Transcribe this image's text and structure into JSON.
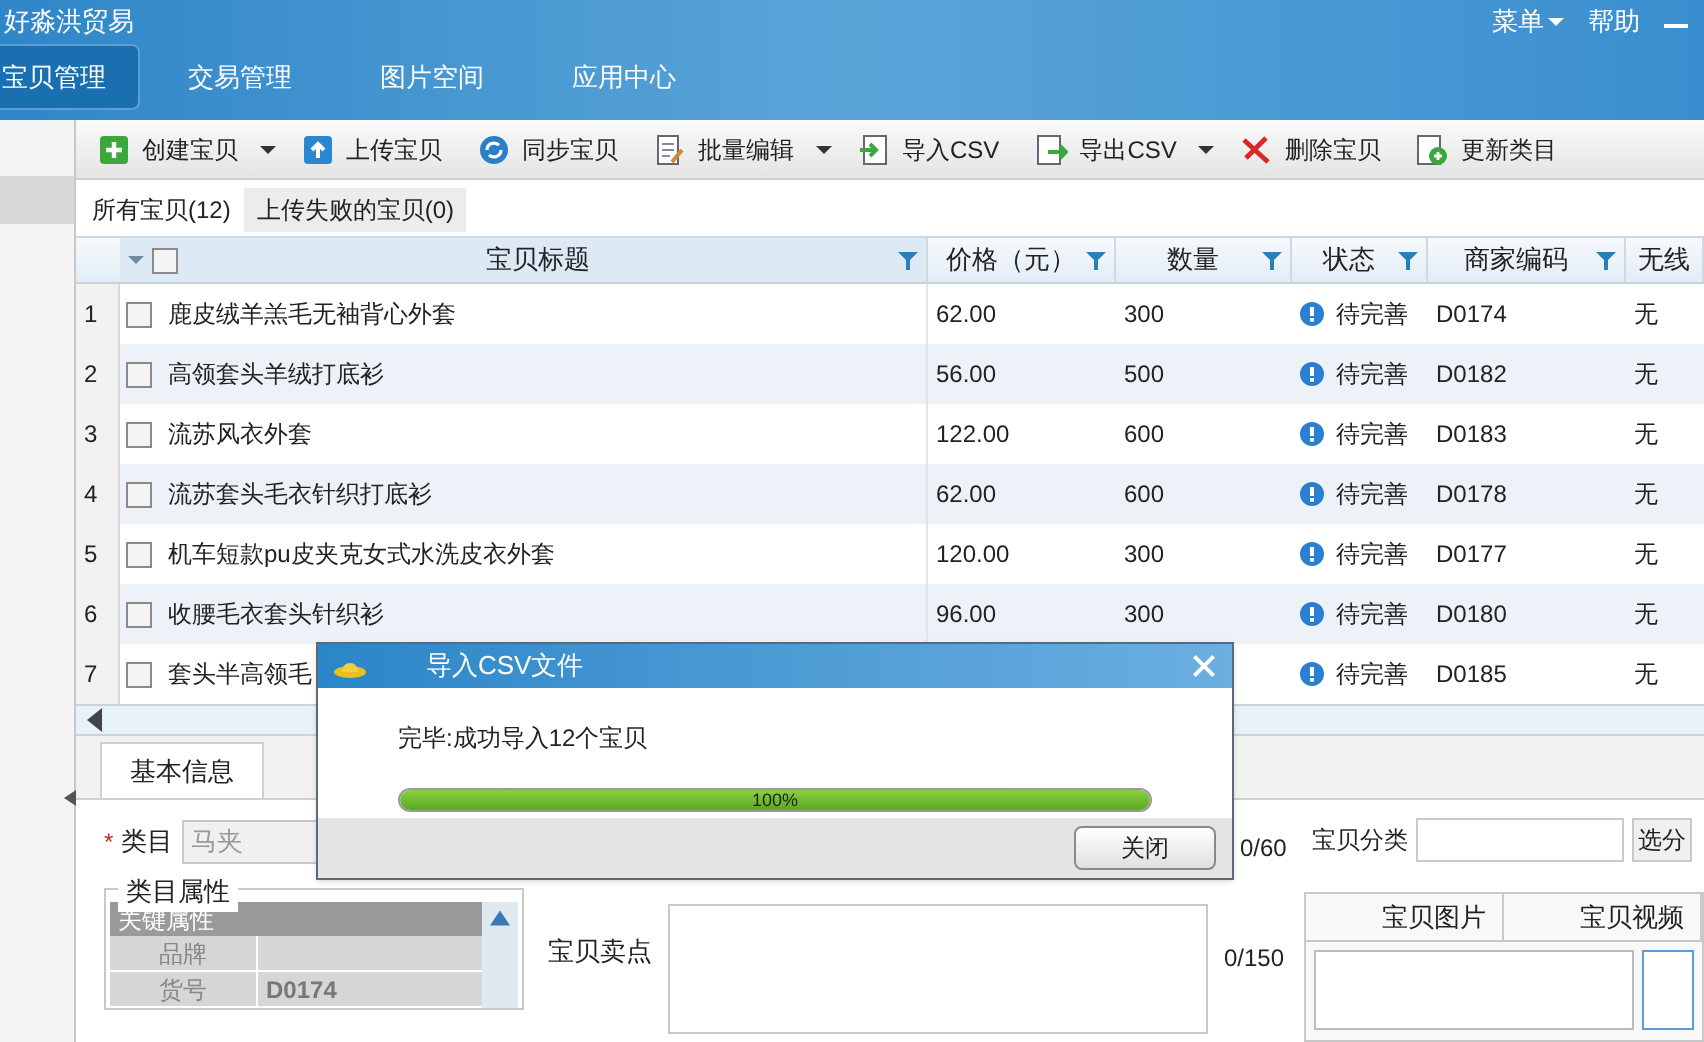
{
  "header": {
    "title": "好淼洪贸易",
    "menu": "菜单",
    "help": "帮助"
  },
  "nav": [
    {
      "label": "宝贝管理",
      "selected": true
    },
    {
      "label": "交易管理",
      "selected": false
    },
    {
      "label": "图片空间",
      "selected": false
    },
    {
      "label": "应用中心",
      "selected": false
    }
  ],
  "toolbar": [
    {
      "label": "创建宝贝",
      "kind": "plus",
      "dropdown": true
    },
    {
      "label": "上传宝贝",
      "kind": "upload",
      "dropdown": false
    },
    {
      "label": "同步宝贝",
      "kind": "sync",
      "dropdown": false
    },
    {
      "label": "批量编辑",
      "kind": "edit",
      "dropdown": true
    },
    {
      "label": "导入CSV",
      "kind": "import",
      "dropdown": false
    },
    {
      "label": "导出CSV",
      "kind": "export",
      "dropdown": true
    },
    {
      "label": "删除宝贝",
      "kind": "delete",
      "dropdown": false
    },
    {
      "label": "更新类目",
      "kind": "refresh",
      "dropdown": false
    }
  ],
  "subtabs": [
    {
      "label": "所有宝贝(12)",
      "selected": true
    },
    {
      "label": "上传失败的宝贝(0)",
      "selected": false
    }
  ],
  "table": {
    "select_all_checked": false,
    "columns": [
      "宝贝标题",
      "价格（元）",
      "数量",
      "状态",
      "商家编码",
      "无线"
    ],
    "rows": [
      {
        "index": "1",
        "title": "鹿皮绒羊羔毛无袖背心外套",
        "price": "62.00",
        "qty": "300",
        "status": "待完善",
        "code": "D0174",
        "mobile": "无",
        "checked": false
      },
      {
        "index": "2",
        "title": "高领套头羊绒打底衫",
        "price": "56.00",
        "qty": "500",
        "status": "待完善",
        "code": "D0182",
        "mobile": "无",
        "checked": false
      },
      {
        "index": "3",
        "title": "流苏风衣外套",
        "price": "122.00",
        "qty": "600",
        "status": "待完善",
        "code": "D0183",
        "mobile": "无",
        "checked": false
      },
      {
        "index": "4",
        "title": "流苏套头毛衣针织打底衫",
        "price": "62.00",
        "qty": "600",
        "status": "待完善",
        "code": "D0178",
        "mobile": "无",
        "checked": false
      },
      {
        "index": "5",
        "title": "机车短款pu皮夹克女式水洗皮衣外套",
        "price": "120.00",
        "qty": "300",
        "status": "待完善",
        "code": "D0177",
        "mobile": "无",
        "checked": false
      },
      {
        "index": "6",
        "title": "收腰毛衣套头针织衫",
        "price": "96.00",
        "qty": "300",
        "status": "待完善",
        "code": "D0180",
        "mobile": "无",
        "checked": false
      },
      {
        "index": "7",
        "title": "套头半高领毛",
        "status": "待完善",
        "code": "D0185",
        "mobile": "无",
        "checked": false
      }
    ]
  },
  "detail": {
    "tabs": [
      {
        "label": "基本信息",
        "selected": true
      }
    ],
    "required_mark": "*",
    "category_label": "类目",
    "category_value": "马夹",
    "title_count": "0/60",
    "classify_label": "宝贝分类",
    "classify_button": "选分",
    "attrs_title": "类目属性",
    "attrs_header": "关键属性",
    "attrs": [
      {
        "name": "品牌"
      },
      {
        "name": "货号",
        "value": "D0174"
      }
    ],
    "selling_label": "宝贝卖点",
    "selling_count": "0/150",
    "media_tabs": [
      "宝贝图片",
      "宝贝视频"
    ]
  },
  "dialog": {
    "title": "导入CSV文件",
    "message": "完毕:成功导入12个宝贝",
    "level": 1,
    "percent": "100%",
    "button": "关闭"
  }
}
